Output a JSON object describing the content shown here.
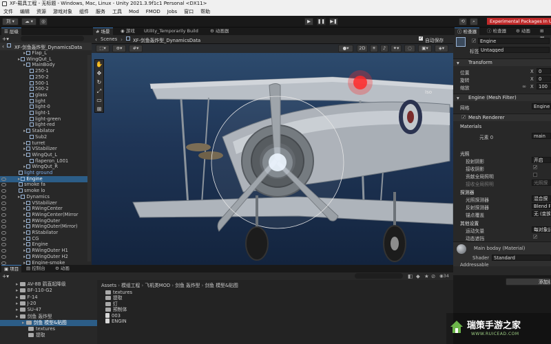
{
  "window": {
    "title": "XF-载具工程 - 无标题 - Windows, Mac, Linux - Unity 2021.3.9f1c1 Personal <DX11>"
  },
  "menu": [
    "文件",
    "编辑",
    "资源",
    "游戏对象",
    "组件",
    "服务",
    "工具",
    "Mod",
    "FMOD",
    "Jobs",
    "窗口",
    "帮助"
  ],
  "toolbar": {
    "account": "刘 ▾",
    "cloud": "☁ ▾",
    "experimental": "Experimental Packages In Us"
  },
  "hierarchy": {
    "tab": "层级",
    "breadcrumb": "XF-剑鱼轰炸型_DynamicsData",
    "rows": [
      {
        "label": "Flap_L",
        "indent": 1
      },
      {
        "label": "WingQut_L",
        "indent": 0
      },
      {
        "label": "MainBody",
        "indent": 1
      },
      {
        "label": "250-1",
        "indent": 2
      },
      {
        "label": "250-2",
        "indent": 2
      },
      {
        "label": "500-1",
        "indent": 2
      },
      {
        "label": "500-2",
        "indent": 2
      },
      {
        "label": "glass",
        "indent": 2
      },
      {
        "label": "light",
        "indent": 2
      },
      {
        "label": "light-0",
        "indent": 2
      },
      {
        "label": "light-1",
        "indent": 2
      },
      {
        "label": "light-green",
        "indent": 2
      },
      {
        "label": "light-red",
        "indent": 2
      },
      {
        "label": "Stabilator",
        "indent": 1
      },
      {
        "label": "Sub2",
        "indent": 2
      },
      {
        "label": "turret",
        "indent": 1
      },
      {
        "label": "VStabilizer",
        "indent": 1
      },
      {
        "label": "WingQut_L",
        "indent": 1
      },
      {
        "label": "flaperon_L001",
        "indent": 2
      },
      {
        "label": "WingQut_R",
        "indent": 1
      },
      {
        "label": "light ground",
        "indent": 0
      },
      {
        "label": "Engine",
        "indent": 0
      },
      {
        "label": "smoke fa",
        "indent": 0
      },
      {
        "label": "smoke lo",
        "indent": 0
      },
      {
        "label": "Dynamics",
        "indent": 0
      },
      {
        "label": "VStabilizer",
        "indent": 1
      },
      {
        "label": "RWingCenter",
        "indent": 1
      },
      {
        "label": "RWingCenter(Mirror",
        "indent": 1
      },
      {
        "label": "RWingOuter",
        "indent": 1
      },
      {
        "label": "RWingOuter(Mirror)",
        "indent": 1
      },
      {
        "label": "RStabilator",
        "indent": 1
      },
      {
        "label": "CG",
        "indent": 1
      },
      {
        "label": "Engine",
        "indent": 1
      },
      {
        "label": "RWingOuter H1",
        "indent": 1
      },
      {
        "label": "RWingOuter H2",
        "indent": 1
      },
      {
        "label": "Engine-smoke",
        "indent": 1
      }
    ]
  },
  "scene": {
    "tabs": [
      "场景",
      "游戏",
      "Utility_Temporarily Build",
      "动画器"
    ],
    "breadcrumb_root": "Scenes",
    "breadcrumb": "XF-剑鱼轰炸型_DynamicsData",
    "autosave": "自动保存",
    "mode2d": "2D",
    "iso": "Iso"
  },
  "inspector": {
    "tabs": [
      "检查器",
      "检查器",
      "动画",
      "图"
    ],
    "object_name": "Engine",
    "tag_label": "标签",
    "tag_value": "Untagged",
    "transform": "Transform",
    "position": "位置",
    "rotation": "旋转",
    "scale": "缩放",
    "x": "X",
    "pos_x": "0",
    "rot_x": "0",
    "scale_x": "100",
    "mesh_filter": "Engine (Mesh Filter)",
    "mesh_label": "网格",
    "mesh_value": "Engine",
    "mesh_renderer": "Mesh Renderer",
    "materials": "Materials",
    "element0": "元素 0",
    "element0_value": "main",
    "lighting": "光照",
    "cast_shadows": "投射阴影",
    "cast_shadows_value": "开启",
    "receive_shadows": "接收阴影",
    "contribute_gi": "贡献全局照明",
    "receive_gi": "接收全局照明",
    "receive_gi_value": "光照探",
    "probes": "探测器",
    "light_probes": "光照探测器",
    "light_probes_value": "混合探",
    "reflection_probes": "反射探测器",
    "reflection_probes_value": "Blend P",
    "anchor_override": "锚点覆盖",
    "anchor_override_value": "无 (变换)",
    "additional": "其他设置",
    "motion_vectors": "运动矢量",
    "motion_vectors_value": "每对象运",
    "dynamic_occlusion": "动态遮挡",
    "material_name": "Main boday (Material)",
    "shader_label": "Shader",
    "shader_value": "Standard",
    "addressable": "Addressable",
    "add_component": "添加组"
  },
  "project": {
    "tabs": [
      "项目",
      "控制台",
      "动画"
    ],
    "count": "34",
    "tree": [
      {
        "label": "AV-8B 鹞直起降级",
        "indent": 1
      },
      {
        "label": "BF-110-G2",
        "indent": 1
      },
      {
        "label": "F-14",
        "indent": 1
      },
      {
        "label": "J-20",
        "indent": 1
      },
      {
        "label": "SU-47",
        "indent": 1
      },
      {
        "label": "剑鱼 轰炸型",
        "indent": 1
      },
      {
        "label": "剑鱼 模型&贴图",
        "indent": 2
      },
      {
        "label": "textures",
        "indent": 3
      },
      {
        "label": "提取",
        "indent": 3
      }
    ],
    "path": [
      "Assets",
      "模组工程",
      "飞机类MOD",
      "剑鱼 轰炸型",
      "剑鱼 模型&贴图"
    ],
    "files": [
      "textures",
      "提取",
      "灯",
      "预制体",
      "003",
      "ENGIN"
    ]
  },
  "watermark": {
    "title": "瑞策手游之家",
    "url": "WWW.RUICEAD.COM"
  }
}
